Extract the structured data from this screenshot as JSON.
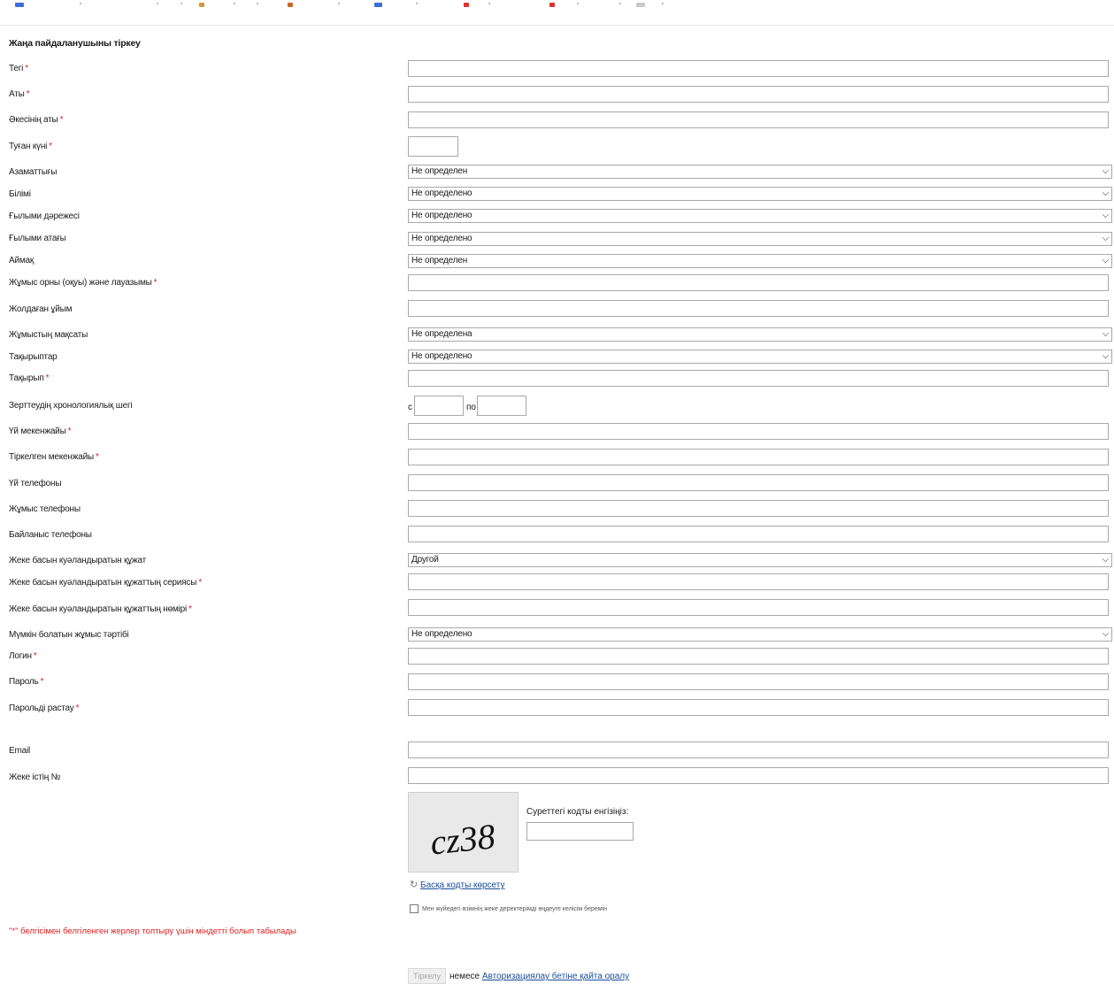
{
  "form": {
    "title": "Жаңа пайдаланушыны тіркеу",
    "required_mark": "*",
    "fields": {
      "surname": "Тегі",
      "name": "Аты",
      "patronymic": "Әкесінің аты",
      "birth_date": "Туған күні",
      "citizenship": "Азаматтығы",
      "education": "Білімі",
      "academic_degree": "Ғылыми дәрежесі",
      "academic_title": "Ғылыми атағы",
      "region": "Аймақ",
      "workplace": "Жұмыс орны (оқуы) және лауазымы",
      "sending_org": "Жолдаған ұйым",
      "work_purpose": "Жұмыстың мақсаты",
      "topics": "Тақырыптар",
      "topic": "Тақырып",
      "chrono_limits": "Зерттеудің хронологиялық шегі",
      "home_address": "Үй мекенжайы",
      "registered_address": "Тіркелген мекенжайы",
      "home_phone": "Үй телефоны",
      "work_phone": "Жұмыс телефоны",
      "contact_phone": "Байланыс телефоны",
      "id_document": "Жеке басын куәландыратын құжат",
      "id_series": "Жеке басын куәландыратын құжаттың сериясы",
      "id_number": "Жеке басын куәландыратын құжаттың нөмірі",
      "work_mode": "Мүмкін болатын жұмыс тәртібі",
      "login": "Логин",
      "password": "Пароль",
      "password_confirm": "Парольді растау",
      "email": "Email",
      "personal_file": "Жеке істің №"
    },
    "selects": {
      "citizenship": "Не определен",
      "education": "Не определено",
      "academic_degree": "Не определено",
      "academic_title": "Не определено",
      "region": "Не определен",
      "work_purpose": "Не определена",
      "topics": "Не определено",
      "id_document": "Другой",
      "work_mode": "Не определено"
    },
    "chrono": {
      "from": "с",
      "to": "по"
    },
    "captcha": {
      "code": "cz38",
      "prompt": "Суреттегі кодты енгізіңіз:",
      "refresh": "Басқа кодты көрсету"
    },
    "consent": "Мен жүйедегі өзімнің жеке деректерімді өңдеуге келісім беремін",
    "required_note": "\"*\" белгісімен белгіленген жерлер толтыру үшін міндетті болып табылады",
    "submit": "Тіркелу",
    "or": "немесе",
    "back_link": "Авторизациялау бетіне қайта оралу"
  },
  "colors": {
    "required": "#e02020",
    "link": "#1a4d9a"
  }
}
